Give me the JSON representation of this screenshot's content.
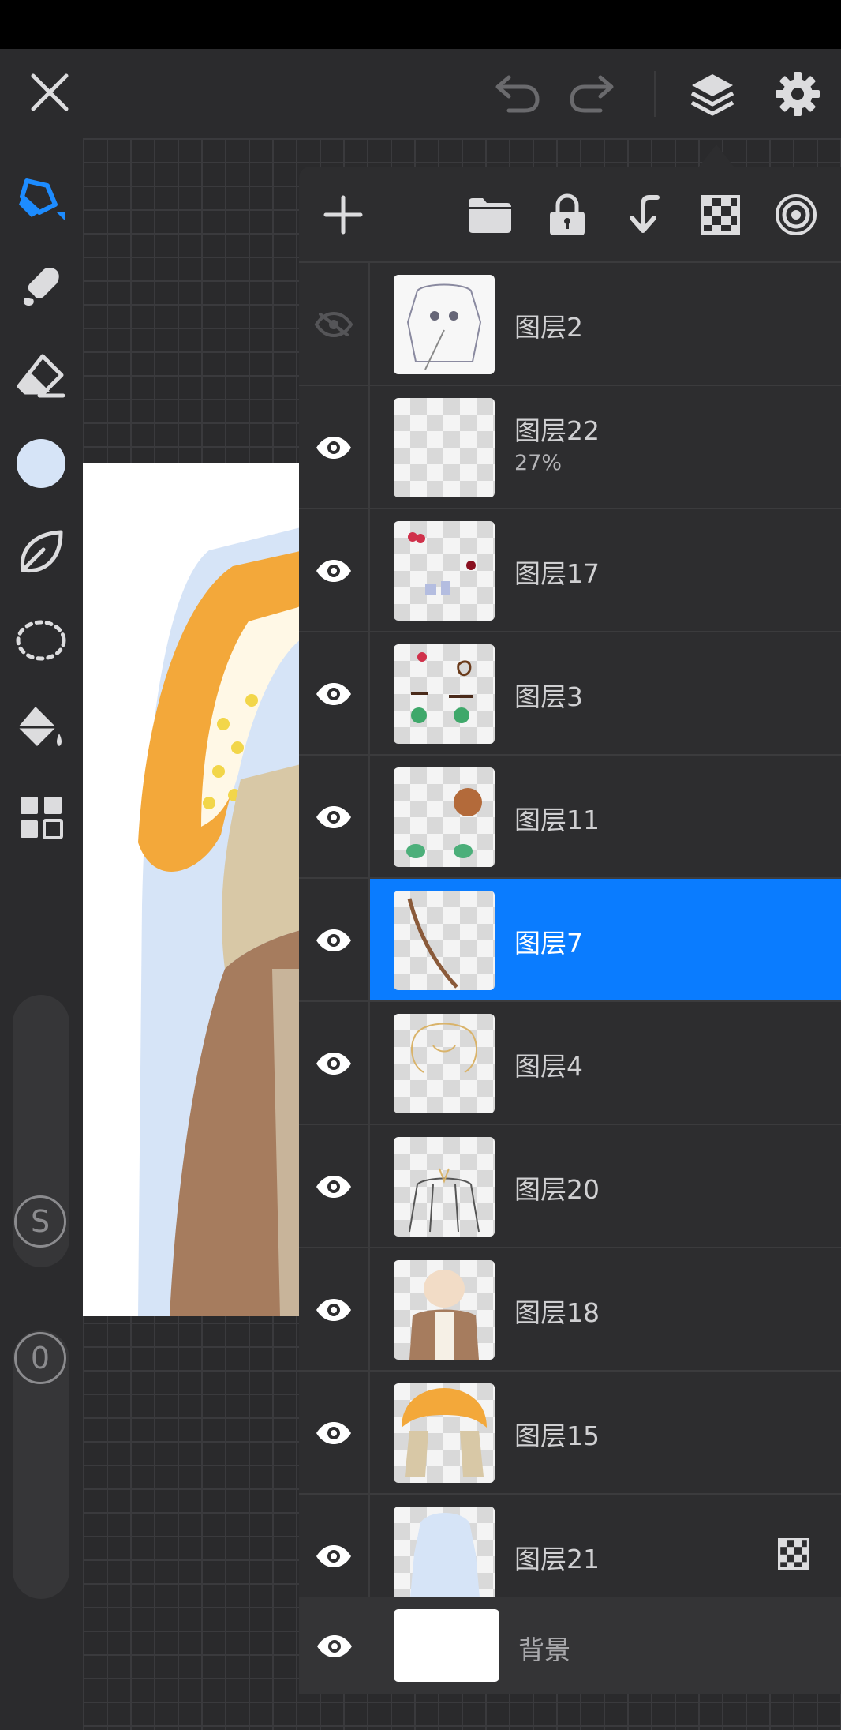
{
  "app": {
    "colors": {
      "accent": "#0a7cff",
      "active_tool": "#1d8cff",
      "current_color": "#d6e4f7",
      "panel_bg": "#2d2d2f",
      "toolbar_bg": "#2b2b2d",
      "icon": "#dcdcde",
      "icon_dim": "#6a6a6d"
    }
  },
  "topbar": {
    "icons": [
      "close-icon",
      "undo-icon",
      "redo-icon",
      "layers-icon",
      "settings-icon"
    ]
  },
  "tools": {
    "items": [
      "brush-icon",
      "smudge-icon",
      "eraser-icon",
      "color-swatch",
      "shape-leaf-icon",
      "lasso-select-icon",
      "fill-bucket-icon",
      "grid-apps-icon"
    ],
    "size_badge": "S",
    "opacity_badge": "0"
  },
  "layers_panel": {
    "header_icons": [
      "add-layer-icon",
      "folder-icon",
      "lock-icon",
      "merge-down-icon",
      "transparency-checker-icon",
      "reference-target-icon"
    ],
    "layers": [
      {
        "name": "图层2",
        "visible": false,
        "sub": ""
      },
      {
        "name": "图层22",
        "visible": true,
        "sub": "27%"
      },
      {
        "name": "图层17",
        "visible": true,
        "sub": ""
      },
      {
        "name": "图层3",
        "visible": true,
        "sub": ""
      },
      {
        "name": "图层11",
        "visible": true,
        "sub": ""
      },
      {
        "name": "图层7",
        "visible": true,
        "sub": "",
        "selected": true
      },
      {
        "name": "图层4",
        "visible": true,
        "sub": ""
      },
      {
        "name": "图层20",
        "visible": true,
        "sub": ""
      },
      {
        "name": "图层18",
        "visible": true,
        "sub": ""
      },
      {
        "name": "图层15",
        "visible": true,
        "sub": ""
      },
      {
        "name": "图层21",
        "visible": true,
        "sub": "",
        "blend": "transparency-checker-icon"
      }
    ],
    "background": {
      "name": "背景",
      "visible": true
    }
  }
}
